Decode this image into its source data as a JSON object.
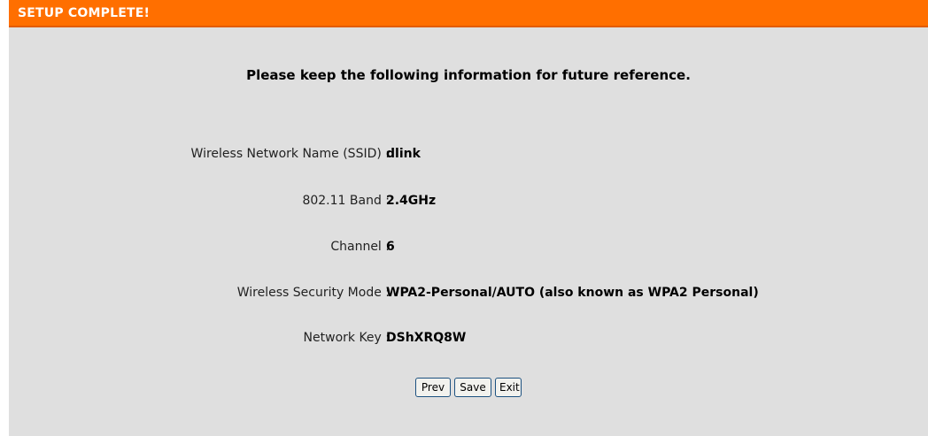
{
  "header": {
    "title": "SETUP COMPLETE!"
  },
  "notice": "Please keep the following information for future reference.",
  "rows": [
    {
      "label": "Wireless Network Name (SSID) :",
      "value": "dlink"
    },
    {
      "label": "802.11 Band :",
      "value": "2.4GHz"
    },
    {
      "label": "Channel :",
      "value": "6"
    },
    {
      "label": "Wireless Security Mode :",
      "value": "WPA2-Personal/AUTO (also known as WPA2 Personal)"
    },
    {
      "label": "Network Key :",
      "value": "DShXRQ8W"
    }
  ],
  "buttons": {
    "prev": "Prev",
    "save": "Save",
    "exit": "Exit"
  },
  "colors": {
    "header": "#ff6f00",
    "panel": "#dfdfdf",
    "button_border": "#1c5180"
  }
}
